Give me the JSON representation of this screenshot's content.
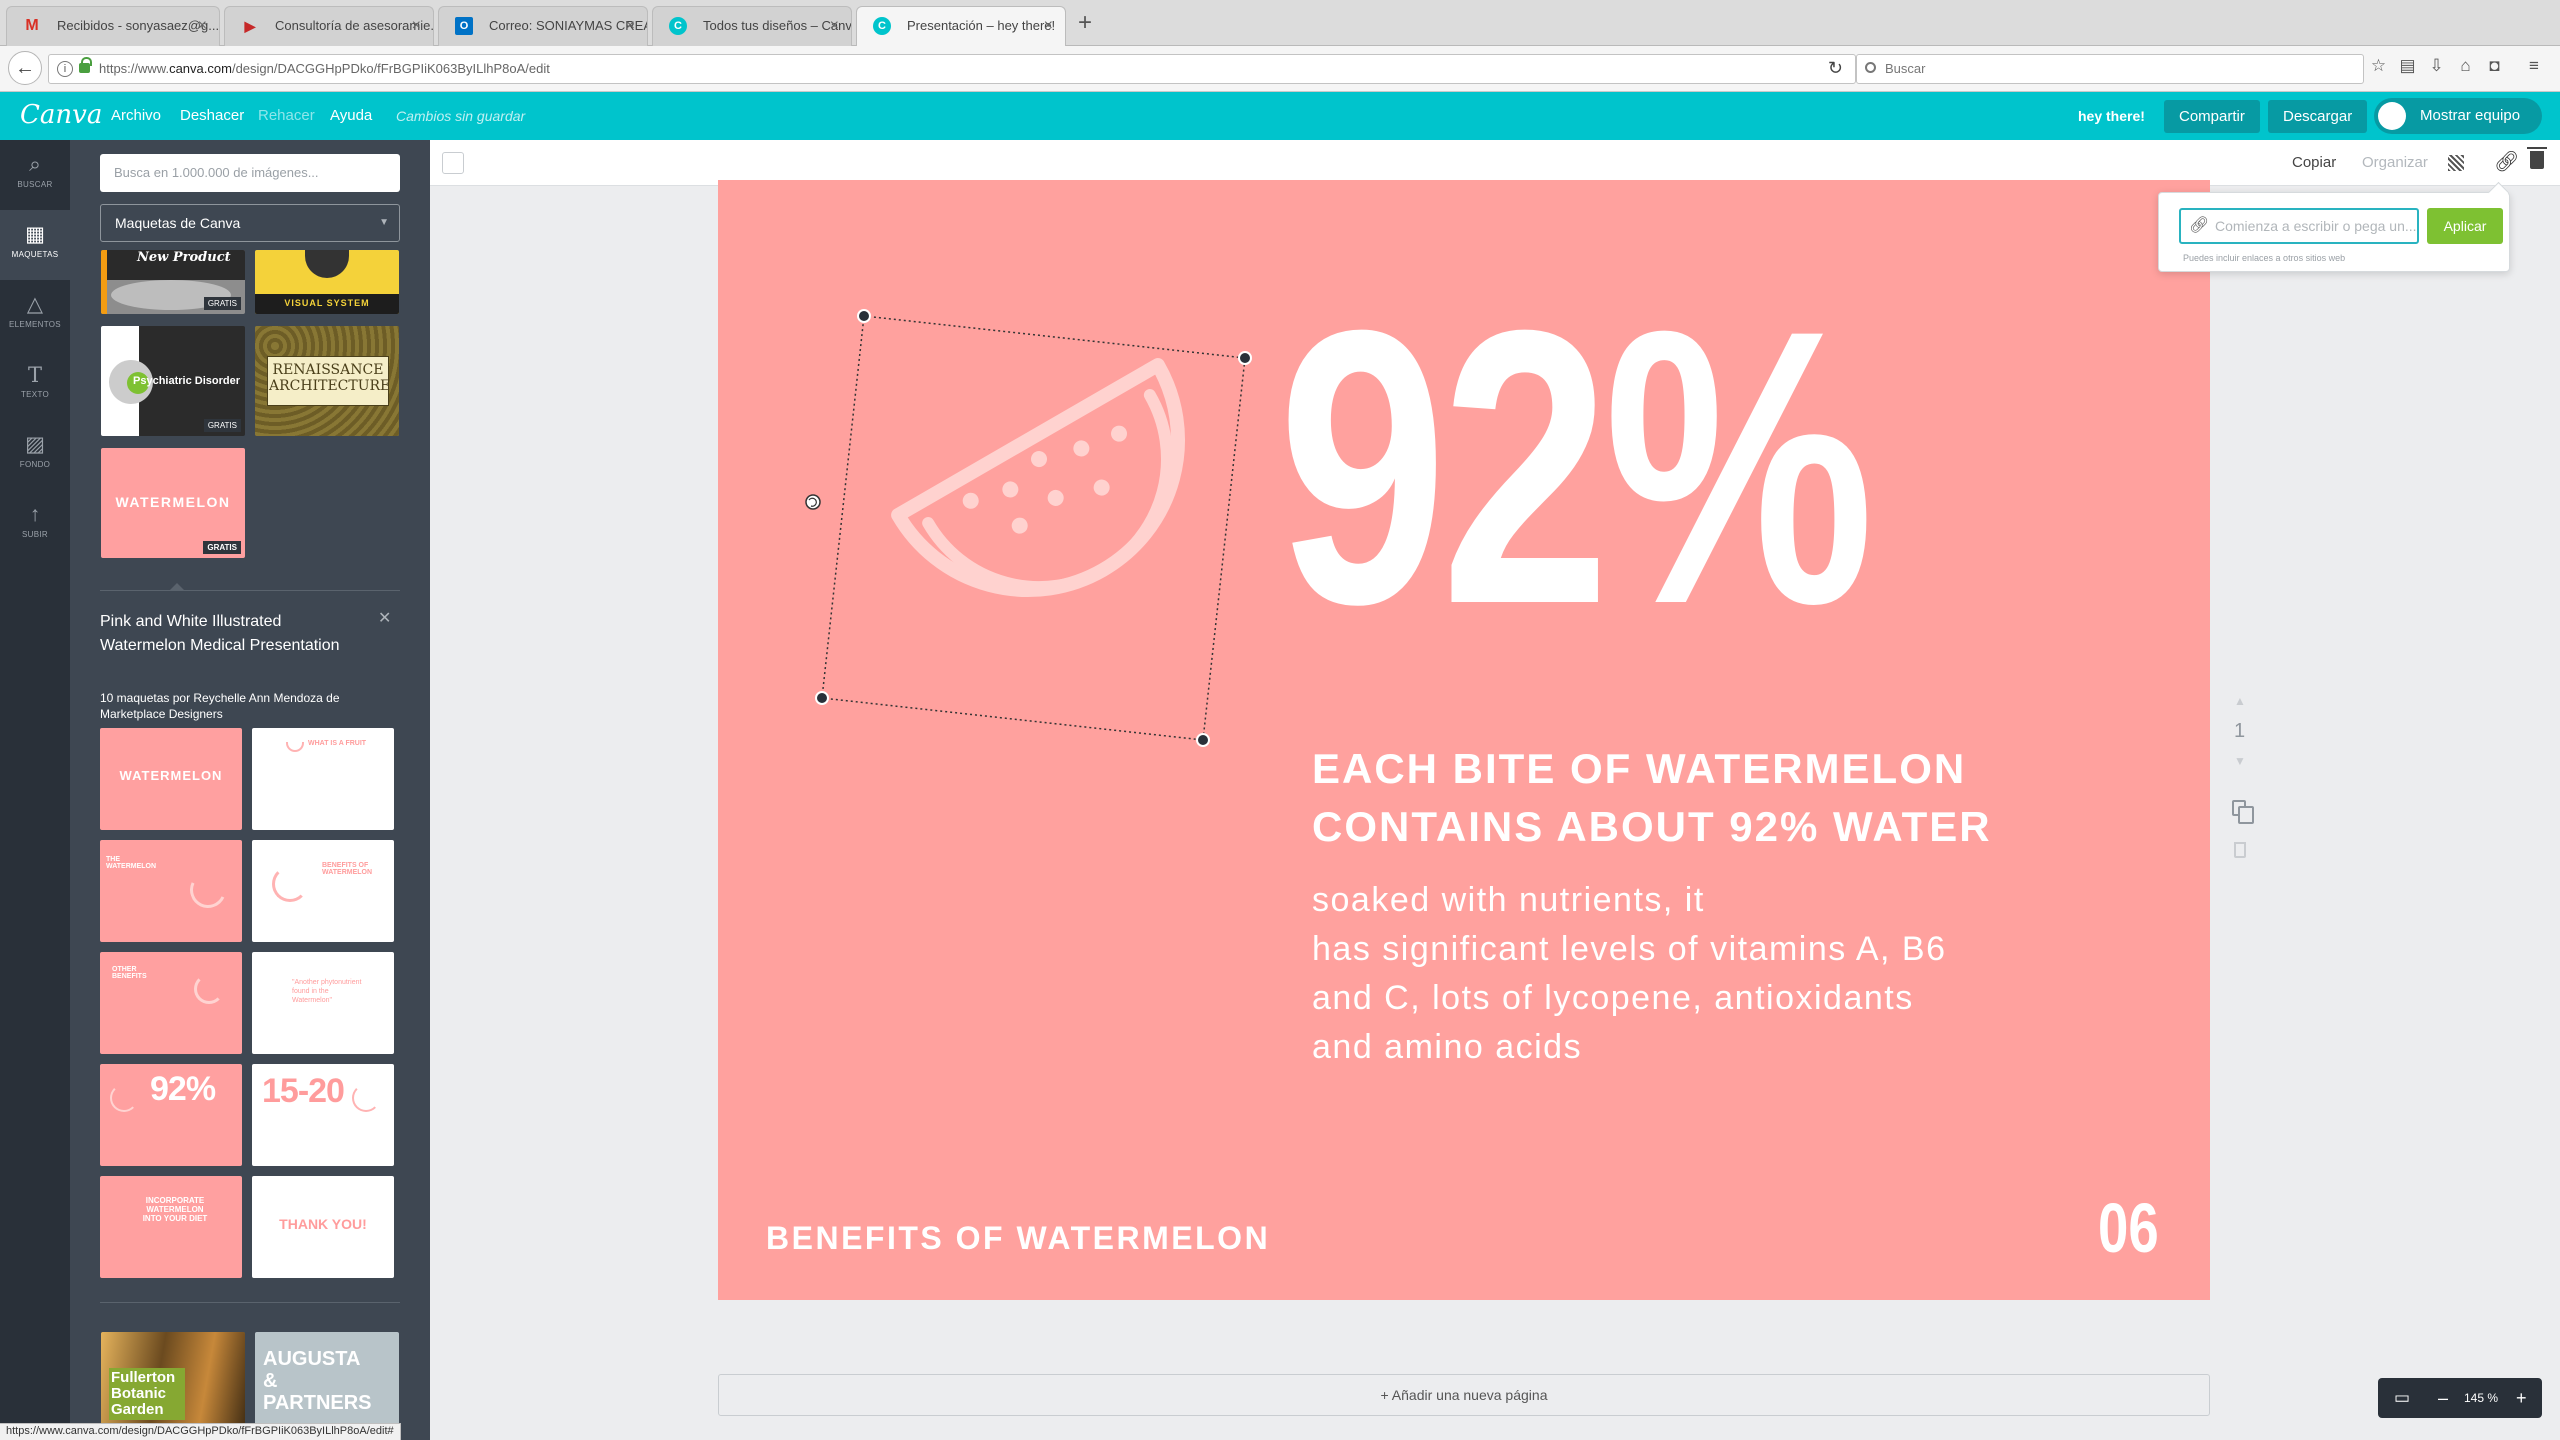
{
  "browser": {
    "tabs": [
      {
        "title": "Recibidos - sonyasaez@g...",
        "favicon": "gmail-icon",
        "color": "#d93025",
        "active": false
      },
      {
        "title": "Consultoría de asesoramie...",
        "favicon": "play-icon",
        "color": "#c62828",
        "active": false
      },
      {
        "title": "Correo: SONIAYMAS CREA...",
        "favicon": "outlook-icon",
        "color": "#0072c6",
        "active": false
      },
      {
        "title": "Todos tus diseños – Canva",
        "favicon": "canva-icon",
        "color": "#00c4cc",
        "active": false
      },
      {
        "title": "Presentación – hey there!",
        "favicon": "canva-icon",
        "color": "#00c4cc",
        "active": true
      }
    ],
    "url_prefix": "https://www.",
    "url_domain": "canva.com",
    "url_path": "/design/DACGGHpPDko/fFrBGPIiK063ByILlhP8oA/edit",
    "search_placeholder": "Buscar",
    "status_url": "https://www.canva.com/design/DACGGHpPDko/fFrBGPIiK063ByILlhP8oA/edit#"
  },
  "canva": {
    "logo": "Canva",
    "menu": [
      "Archivo",
      "Deshacer",
      "Rehacer",
      "Ayuda"
    ],
    "save_status": "Cambios sin guardar",
    "greeting": "hey there!",
    "share_label": "Compartir",
    "download_label": "Descargar",
    "team_label": "Mostrar equipo",
    "accent": "#00c4cc"
  },
  "rail": [
    {
      "label": "BUSCAR",
      "icon": "search-icon",
      "glyph": "⌕"
    },
    {
      "label": "MAQUETAS",
      "icon": "layouts-icon",
      "glyph": "▦"
    },
    {
      "label": "ELEMENTOS",
      "icon": "elements-icon",
      "glyph": "△"
    },
    {
      "label": "TEXTO",
      "icon": "text-icon",
      "glyph": "T"
    },
    {
      "label": "FONDO",
      "icon": "background-icon",
      "glyph": "▨"
    },
    {
      "label": "SUBIR",
      "icon": "upload-icon",
      "glyph": "↑"
    }
  ],
  "panel": {
    "search_placeholder": "Busca en 1.000.000 de imágenes...",
    "select_value": "Maquetas de Canva",
    "badge": "GRATIS",
    "templates_top": [
      "New Product",
      "VISUAL SYSTEM",
      "Psychiatric Disorder",
      "RENAISSANCE ARCHITECTURE",
      "WATERMELON"
    ],
    "set_title": "Pink and White Illustrated Watermelon Medical Presentation",
    "set_author": "10 maquetas por Reychelle Ann Mendoza de Marketplace Designers",
    "set_thumbs": [
      "WATERMELON",
      "WHAT IS A FRUIT",
      "THE WATERMELON",
      "BENEFITS OF WATERMELON",
      "OTHER BENEFITS",
      "\"Another phytonutrient found in the Watermelon\"",
      "92%",
      "15-20",
      "INCORPORATE WATERMELON INTO YOUR DIET",
      "THANK YOU!"
    ],
    "bottom_thumbs": [
      "Fullerton Botanic Garden",
      "AUGUSTA & PARTNERS"
    ]
  },
  "toolbar": {
    "copy_label": "Copiar",
    "organize_label": "Organizar"
  },
  "link_popup": {
    "placeholder": "Comienza a escribir o pega un...",
    "apply_label": "Aplicar",
    "hint": "Puedes incluir enlaces a otros sitios web"
  },
  "slide": {
    "big_stat": "92%",
    "headline": "EACH BITE OF WATERMELON CONTAINS ABOUT 92% WATER",
    "body_lines": [
      "soaked with nutrients, it",
      "has significant levels of vitamins A, B6",
      "and C, lots of lycopene, antioxidants",
      "and amino acids"
    ],
    "footer_title": "BENEFITS OF WATERMELON",
    "page_label": "06",
    "background": "#ffa19e"
  },
  "page_controls": {
    "page_number": "1"
  },
  "add_page_label": "+ Añadir una nueva página",
  "zoom": {
    "value": "145 %"
  }
}
